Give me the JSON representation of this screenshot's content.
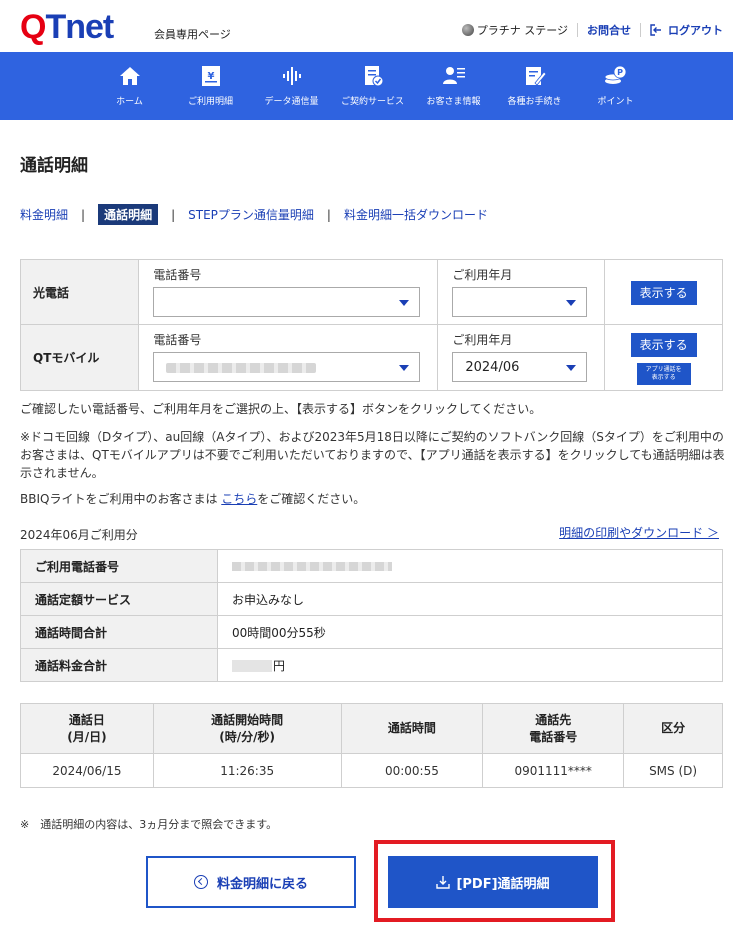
{
  "header": {
    "logo_q": "Q",
    "logo_tnet": "Tnet",
    "member_label": "会員専用ページ",
    "status_label": "プラチナ ステージ",
    "contact_label": "お問合せ",
    "logout_label": "ログアウト"
  },
  "nav": {
    "items": [
      {
        "label": "ホーム",
        "icon": "home-icon"
      },
      {
        "label": "ご利用明細",
        "icon": "bill-icon"
      },
      {
        "label": "データ通信量",
        "icon": "data-usage-icon"
      },
      {
        "label": "ご契約サービス",
        "icon": "contract-icon"
      },
      {
        "label": "お客さま情報",
        "icon": "customer-info-icon"
      },
      {
        "label": "各種お手続き",
        "icon": "procedures-icon"
      },
      {
        "label": "ポイント",
        "icon": "points-icon"
      }
    ]
  },
  "page_title": "通話明細",
  "subtabs": [
    {
      "label": "料金明細",
      "active": false
    },
    {
      "label": "通話明細",
      "active": true
    },
    {
      "label": "STEPプラン通信量明細",
      "active": false
    },
    {
      "label": "料金明細一括ダウンロード",
      "active": false
    }
  ],
  "search": {
    "hikari": {
      "row_label": "光電話",
      "phone_label": "電話番号",
      "phone_value": "",
      "month_label": "ご利用年月",
      "month_value": "",
      "show_button": "表示する"
    },
    "mobile": {
      "row_label": "QTモバイル",
      "phone_label": "電話番号",
      "month_label": "ご利用年月",
      "month_value": "2024/06",
      "show_button": "表示する",
      "app_button_line1": "アプリ通話を",
      "app_button_line2": "表示する"
    }
  },
  "notes": {
    "instruction": "ご確認したい電話番号、ご利用年月をご選択の上、【表示する】ボタンをクリックしてください。",
    "docomo_note": "※ドコモ回線（Dタイプ）、au回線（Aタイプ）、および2023年5月18日以降にご契約のソフトバンク回線（Sタイプ）をご利用中のお客さまは、QTモバイルアプリは不要でご利用いただいておりますので、【アプリ通話を表示する】をクリックしても通話明細は表示されません。",
    "bbiq_before": "BBIQライトをご利用中のお客さまは ",
    "bbiq_link": "こちら",
    "bbiq_after": "をご確認ください。"
  },
  "period_label": "2024年06月ご利用分",
  "print_link": "明細の印刷やダウンロード ＞",
  "summary": {
    "rows": [
      {
        "label": "ご利用電話番号",
        "value": ""
      },
      {
        "label": "通話定額サービス",
        "value": "お申込みなし"
      },
      {
        "label": "通話時間合計",
        "value": "00時間00分55秒"
      },
      {
        "label": "通話料金合計",
        "value": "円"
      }
    ]
  },
  "calls": {
    "headers": [
      {
        "line1": "通話日",
        "line2": "(月/日)"
      },
      {
        "line1": "通話開始時間",
        "line2": "(時/分/秒)"
      },
      {
        "line1": "通話時間",
        "line2": ""
      },
      {
        "line1": "通話先",
        "line2": "電話番号"
      },
      {
        "line1": "区分",
        "line2": ""
      }
    ],
    "rows": [
      {
        "date": "2024/06/15",
        "start": "11:26:35",
        "duration": "00:00:55",
        "number": "0901111****",
        "type": "SMS (D)"
      }
    ]
  },
  "footnote": "※　通話明細の内容は、3ヵ月分まで照会できます。",
  "buttons": {
    "back": "料金明細に戻る",
    "pdf": "[PDF]通話明細"
  },
  "colors": {
    "brand_red": "#e60012",
    "brand_blue": "#1a3fb5",
    "nav_blue": "#2f63e0",
    "button_blue": "#1f55c8",
    "highlight_red": "#e31b23"
  }
}
